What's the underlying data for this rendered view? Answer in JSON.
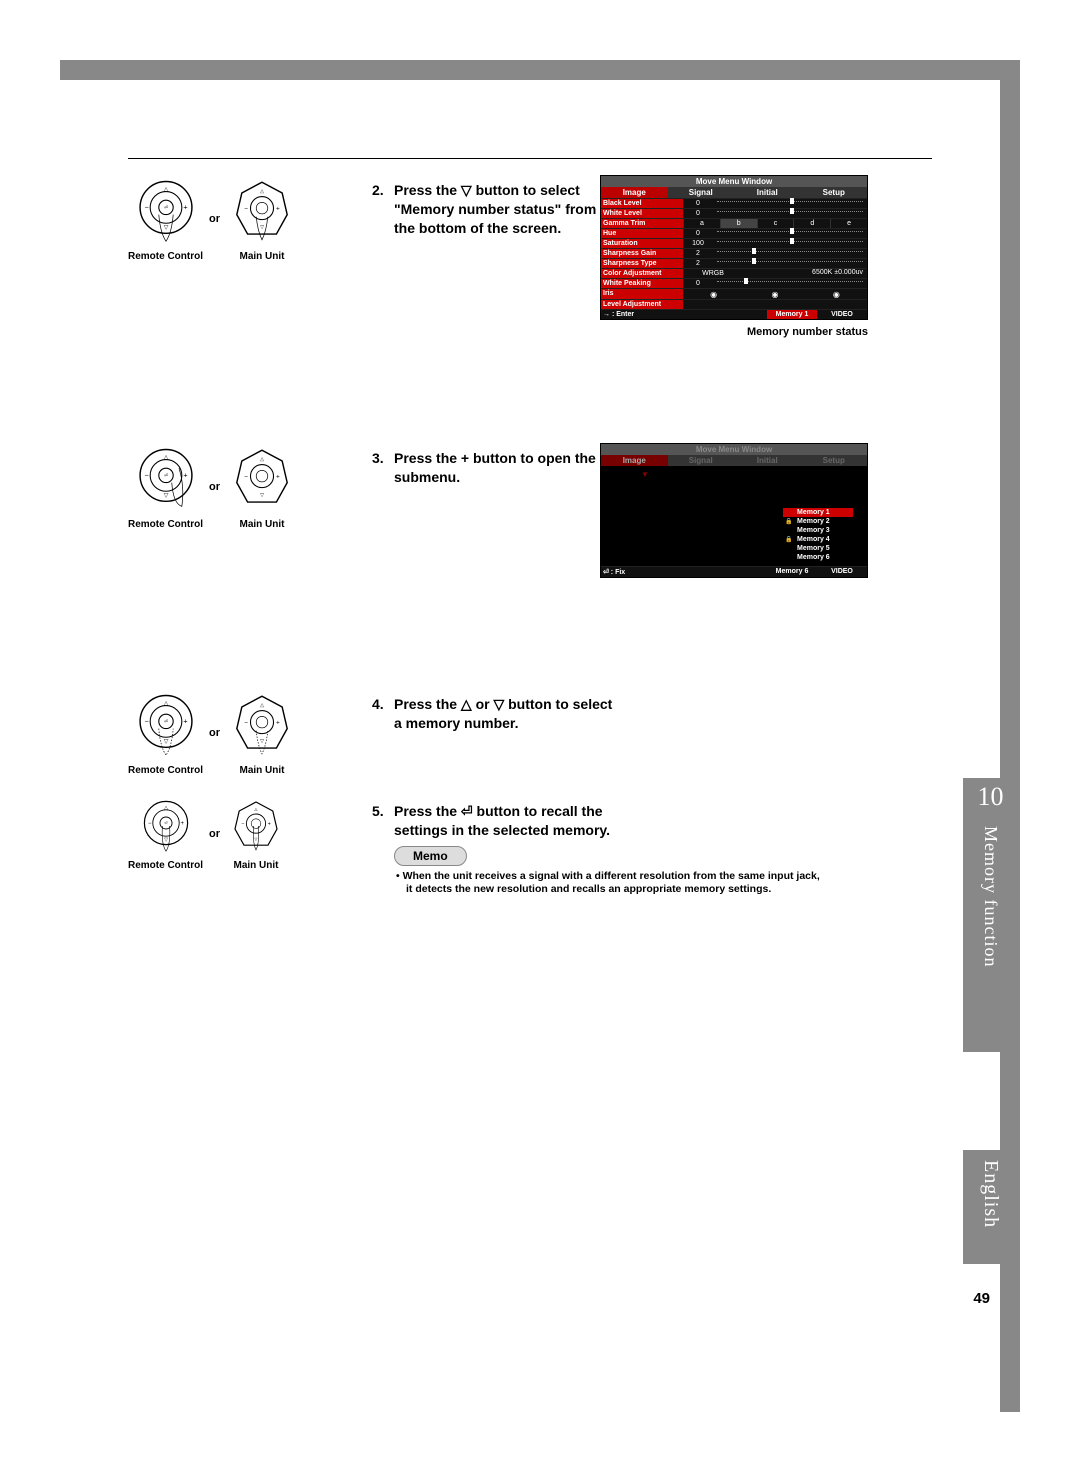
{
  "page": {
    "number": "49",
    "chapter_num": "10",
    "chapter_title": "Memory function",
    "language": "English"
  },
  "labels": {
    "remote": "Remote Control",
    "main": "Main Unit",
    "or": "or"
  },
  "steps": {
    "s2": {
      "num": "2.",
      "text_a": "Press the ▽ button to select",
      "text_b": "\"Memory number status\" from",
      "text_c": "the bottom of the screen."
    },
    "s3": {
      "num": "3.",
      "text_a": "Press the + button to open the",
      "text_b": "submenu."
    },
    "s4": {
      "num": "4.",
      "text_a": "Press the △ or ▽ button to select",
      "text_b": "a memory number."
    },
    "s5": {
      "num": "5.",
      "text_a": "Press the ⏎ button to recall the",
      "text_b": "settings in the selected memory."
    }
  },
  "memo": {
    "label": "Memo",
    "bullet_a": "When the unit receives a signal with a different resolution from the same input jack,",
    "bullet_b": "it detects the new resolution and recalls an appropriate memory settings."
  },
  "osd1": {
    "title": "Move Menu Window",
    "tabs": [
      "Image",
      "Signal",
      "Initial",
      "Setup"
    ],
    "rows": [
      {
        "label": "Black Level",
        "val": "0",
        "slider": 50
      },
      {
        "label": "White Level",
        "val": "0",
        "slider": 50
      },
      {
        "label": "Gamma Trim",
        "val": "",
        "gamma": [
          "a",
          "b",
          "c",
          "d",
          "e"
        ]
      },
      {
        "label": "Hue",
        "val": "0",
        "slider": 50
      },
      {
        "label": "Saturation",
        "val": "100",
        "slider": 50
      },
      {
        "label": "Sharpness Gain",
        "val": "2",
        "slider": 25
      },
      {
        "label": "Sharpness Type",
        "val": "2",
        "slider": 25
      },
      {
        "label": "Color Adjustment",
        "val": "",
        "text": "WRGB",
        "text2": "6500K ±0.000uv"
      },
      {
        "label": "White Peaking",
        "val": "0",
        "slider": 20
      },
      {
        "label": "Iris",
        "val": "",
        "iris": true
      },
      {
        "label": "Level Adjustment",
        "val": ""
      }
    ],
    "status_left": "→ : Enter",
    "status_mid": "Memory 1",
    "status_right": "VIDEO",
    "caption": "Memory number status"
  },
  "osd2": {
    "title": "Move Menu Window",
    "tabs": [
      "Image",
      "Signal",
      "Initial",
      "Setup"
    ],
    "memories": [
      {
        "label": "Memory 1",
        "active": true,
        "lock": false
      },
      {
        "label": "Memory 2",
        "active": false,
        "lock": true
      },
      {
        "label": "Memory 3",
        "active": false,
        "lock": false
      },
      {
        "label": "Memory 4",
        "active": false,
        "lock": true
      },
      {
        "label": "Memory 5",
        "active": false,
        "lock": false
      },
      {
        "label": "Memory 6",
        "active": false,
        "lock": false
      }
    ],
    "status_left": "⏎ : Fix",
    "status_mid": "Memory 6",
    "status_right": "VIDEO"
  }
}
